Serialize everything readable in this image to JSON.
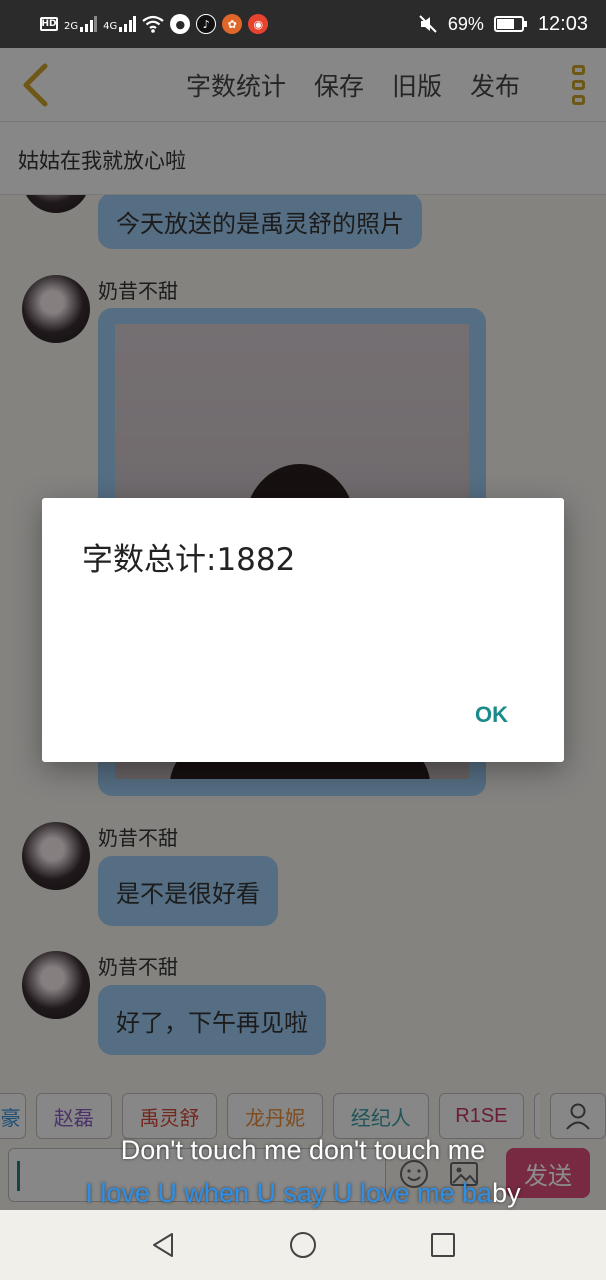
{
  "status_bar": {
    "left_icons": [
      "hd-icon",
      "signal-2g-icon",
      "signal-4g-icon",
      "wifi-icon",
      "globe-icon",
      "tiktok-icon",
      "app-icon",
      "weibo-icon"
    ],
    "net_2g": "2G",
    "net_4g": "4G",
    "hd": "HD",
    "battery_percent": "69%",
    "time": "12:03"
  },
  "appbar": {
    "menu": [
      "字数统计",
      "保存",
      "旧版",
      "发布"
    ]
  },
  "subtitle": "姑姑在我就放心啦",
  "chat": {
    "messages": [
      {
        "name": "",
        "text": "今天放送的是禹灵舒的照片"
      },
      {
        "name": "奶昔不甜",
        "type": "image"
      },
      {
        "name": "奶昔不甜",
        "text": "是不是很好看"
      },
      {
        "name": "奶昔不甜",
        "text": "好了，下午再见啦"
      }
    ]
  },
  "chips": [
    {
      "label": "豪",
      "color": "#3a8fd6"
    },
    {
      "label": "赵磊",
      "color": "#8a5bc4"
    },
    {
      "label": "禹灵舒",
      "color": "#d24a3a"
    },
    {
      "label": "龙丹妮",
      "color": "#e58a3a"
    },
    {
      "label": "经纪人",
      "color": "#3a9aa0"
    },
    {
      "label": "R1SE",
      "color": "#c2336b"
    }
  ],
  "input": {
    "send_label": "发送"
  },
  "dialog": {
    "message": "字数总计:1882",
    "ok_label": "OK"
  },
  "lyrics": {
    "line1": "Don't touch me don't touch me",
    "line2_highlight": "I love U when U say U love me ba",
    "line2_rest": "by"
  }
}
